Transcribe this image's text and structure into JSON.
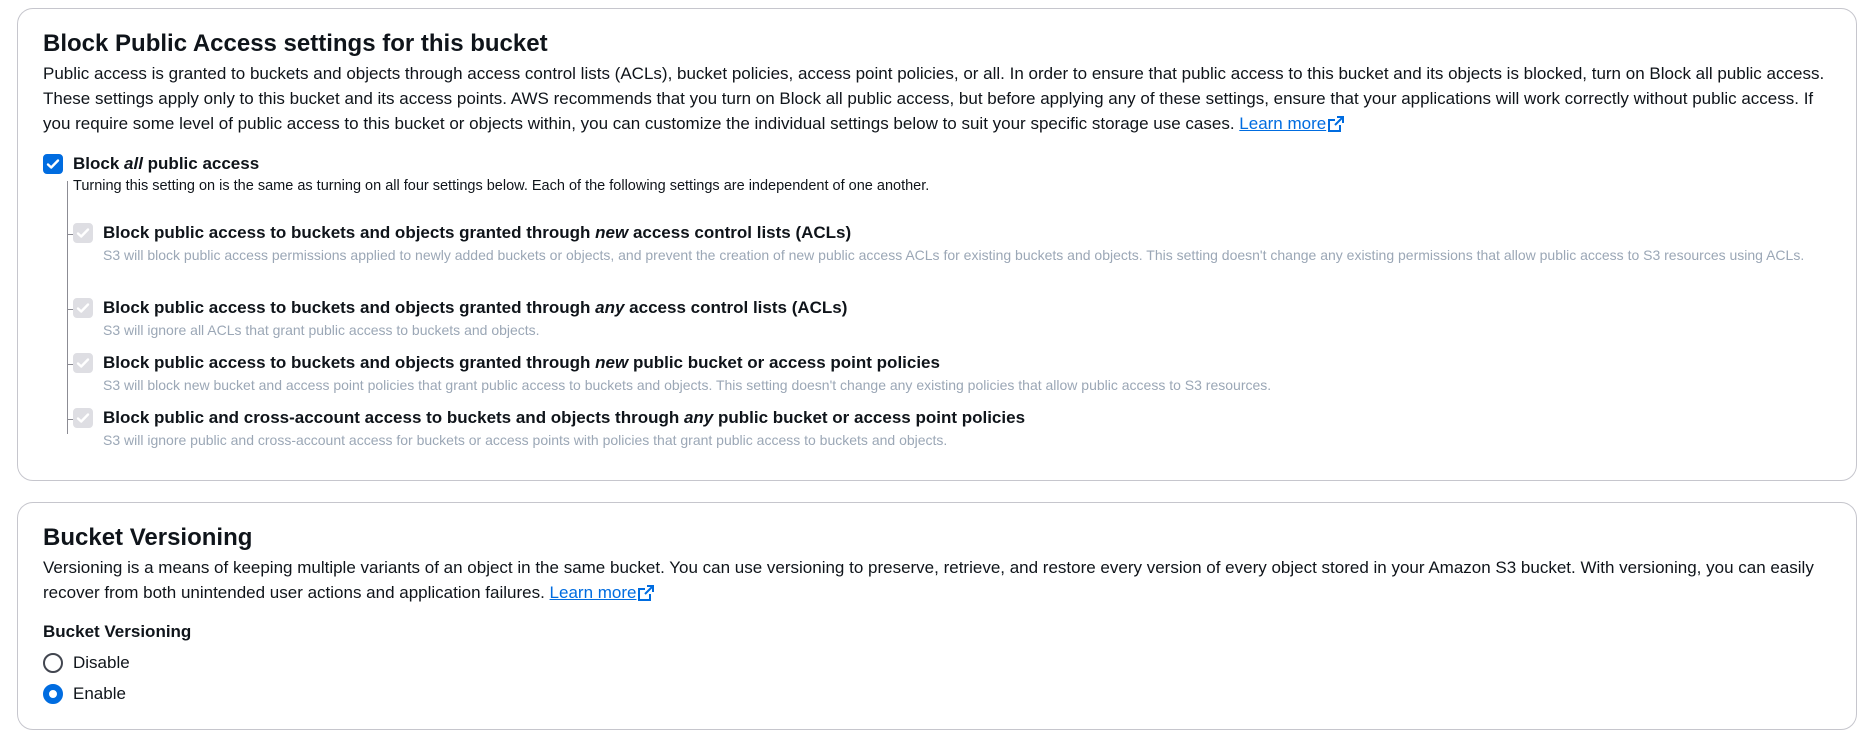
{
  "block_public_access": {
    "title": "Block Public Access settings for this bucket",
    "description": "Public access is granted to buckets and objects through access control lists (ACLs), bucket policies, access point policies, or all. In order to ensure that public access to this bucket and its objects is blocked, turn on Block all public access. These settings apply only to this bucket and its access points. AWS recommends that you turn on Block all public access, but before applying any of these settings, ensure that your applications will work correctly without public access. If you require some level of public access to this bucket or objects within, you can customize the individual settings below to suit your specific storage use cases.",
    "learn_more": "Learn more",
    "block_all": {
      "label_pre": "Block ",
      "label_em": "all",
      "label_post": " public access",
      "checked": true,
      "description": "Turning this setting on is the same as turning on all four settings below. Each of the following settings are independent of one another."
    },
    "sub_settings": [
      {
        "label_pre": "Block public access to buckets and objects granted through ",
        "label_em": "new",
        "label_post": " access control lists (ACLs)",
        "description": "S3 will block public access permissions applied to newly added buckets or objects, and prevent the creation of new public access ACLs for existing buckets and objects. This setting doesn't change any existing permissions that allow public access to S3 resources using ACLs.",
        "checked": true,
        "disabled": true
      },
      {
        "label_pre": "Block public access to buckets and objects granted through ",
        "label_em": "any",
        "label_post": " access control lists (ACLs)",
        "description": "S3 will ignore all ACLs that grant public access to buckets and objects.",
        "checked": true,
        "disabled": true
      },
      {
        "label_pre": "Block public access to buckets and objects granted through ",
        "label_em": "new",
        "label_post": " public bucket or access point policies",
        "description": "S3 will block new bucket and access point policies that grant public access to buckets and objects. This setting doesn't change any existing policies that allow public access to S3 resources.",
        "checked": true,
        "disabled": true
      },
      {
        "label_pre": "Block public and cross-account access to buckets and objects through ",
        "label_em": "any",
        "label_post": " public bucket or access point policies",
        "description": "S3 will ignore public and cross-account access for buckets or access points with policies that grant public access to buckets and objects.",
        "checked": true,
        "disabled": true
      }
    ]
  },
  "bucket_versioning": {
    "title": "Bucket Versioning",
    "description": "Versioning is a means of keeping multiple variants of an object in the same bucket. You can use versioning to preserve, retrieve, and restore every version of every object stored in your Amazon S3 bucket. With versioning, you can easily recover from both unintended user actions and application failures.",
    "learn_more": "Learn more",
    "field_label": "Bucket Versioning",
    "options": [
      {
        "label": "Disable",
        "selected": false
      },
      {
        "label": "Enable",
        "selected": true
      }
    ]
  },
  "icons": {
    "external_link": "external-link-icon",
    "checkmark": "checkmark-icon"
  },
  "colors": {
    "accent": "#006ce0",
    "disabled_check": "#dedee3",
    "muted_text": "#9ba7b6",
    "border": "#c6c6cd"
  }
}
